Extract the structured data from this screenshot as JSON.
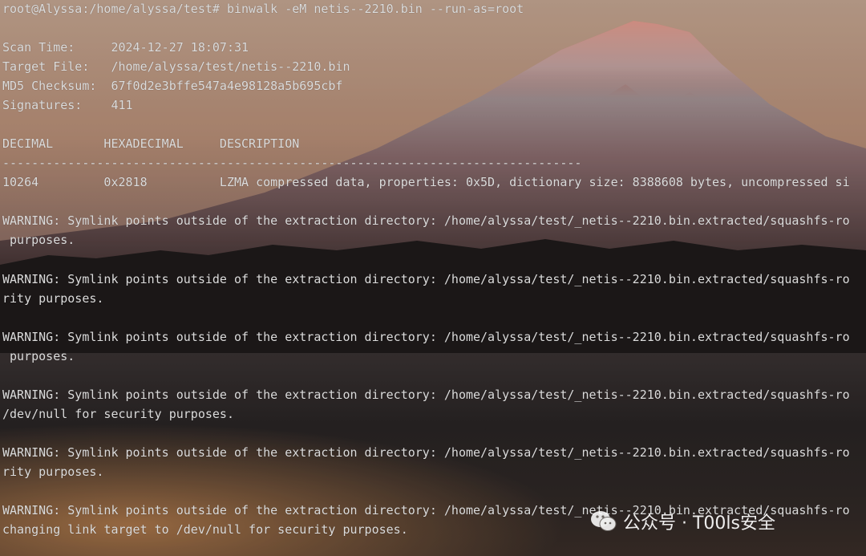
{
  "scene": {
    "background": "photo of Mount Fuji at sunset reflected in a lake",
    "colors": {
      "sky_top": "#c4a48e",
      "sky_mid": "#b58b70",
      "sky_low": "#6f5a55",
      "mountain_glow": "#d9867a",
      "mountain_snow": "#b7a9ab",
      "mountain_base": "#5c4444",
      "treeline": "#1e1b1b",
      "lake": "#2a2626",
      "lake_reflection": "#b07c52",
      "terminal_text": "#dcdcdc"
    }
  },
  "terminal": {
    "lines": [
      "root@Alyssa:/home/alyssa/test# binwalk -eM netis--2210.bin --run-as=root",
      "Scan Time:     2024-12-27 18:07:31",
      "Target File:   /home/alyssa/test/netis--2210.bin",
      "MD5 Checksum:  67f0d2e3bffe547a4e98128a5b695cbf",
      "Signatures:    411",
      "DECIMAL       HEXADECIMAL     DESCRIPTION",
      "--------------------------------------------------------------------------------",
      "10264         0x2818          LZMA compressed data, properties: 0x5D, dictionary size: 8388608 bytes, uncompressed si",
      "WARNING: Symlink points outside of the extraction directory: /home/alyssa/test/_netis--2210.bin.extracted/squashfs-ro",
      " purposes.",
      "WARNING: Symlink points outside of the extraction directory: /home/alyssa/test/_netis--2210.bin.extracted/squashfs-ro",
      "rity purposes.",
      "WARNING: Symlink points outside of the extraction directory: /home/alyssa/test/_netis--2210.bin.extracted/squashfs-ro",
      " purposes.",
      "WARNING: Symlink points outside of the extraction directory: /home/alyssa/test/_netis--2210.bin.extracted/squashfs-ro",
      "/dev/null for security purposes.",
      "WARNING: Symlink points outside of the extraction directory: /home/alyssa/test/_netis--2210.bin.extracted/squashfs-ro",
      "rity purposes.",
      "WARNING: Symlink points outside of the extraction directory: /home/alyssa/test/_netis--2210.bin.extracted/squashfs-ro",
      "changing link target to /dev/null for security purposes."
    ]
  },
  "watermark": {
    "icon": "wechat-icon",
    "text": "公众号 · T00ls安全"
  }
}
